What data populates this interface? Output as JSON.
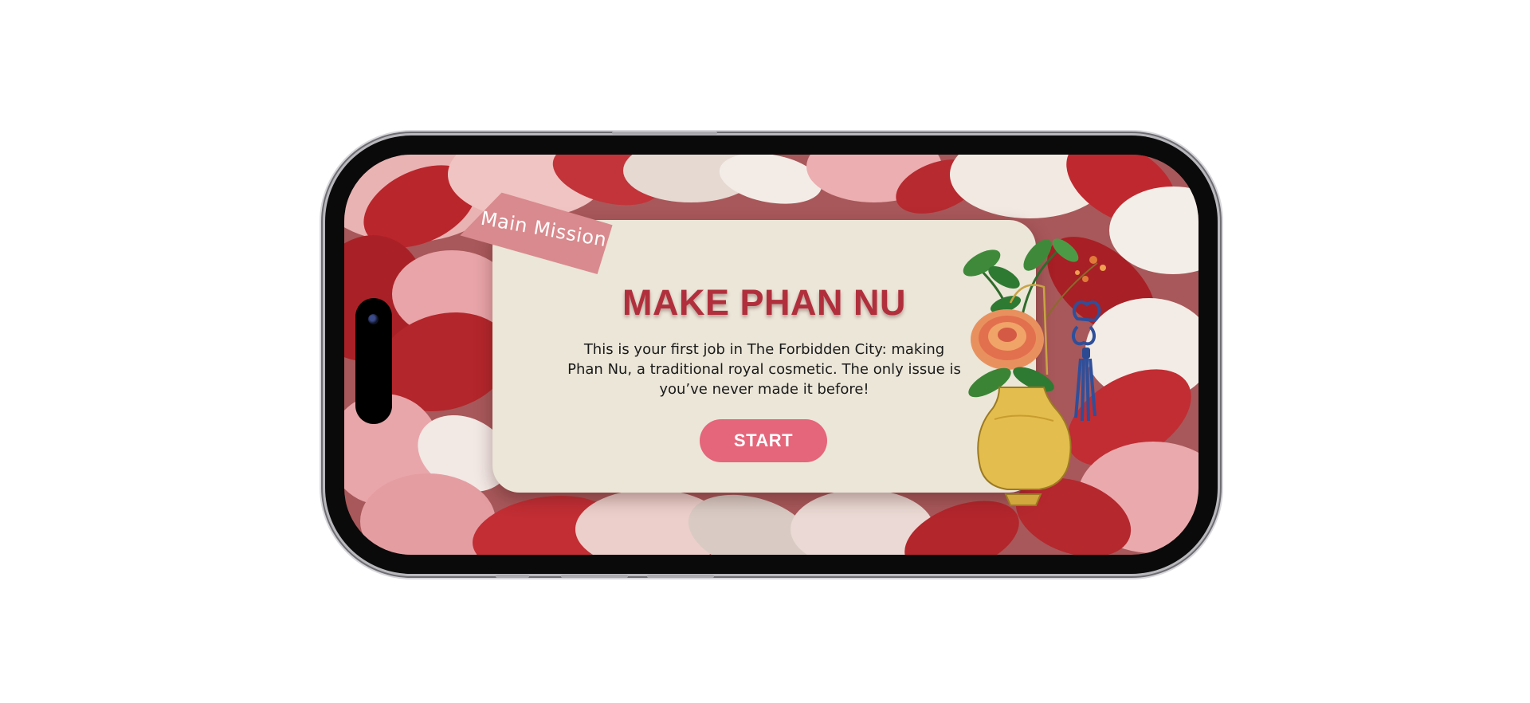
{
  "mission_card": {
    "tag_label": "Main Mission",
    "title": "MAKE PHAN NU",
    "description": "This is your first job in The Forbidden City: making Phan Nu, a traditional royal cosmetic. The only issue is you’ve never made it before!",
    "start_label": "START"
  },
  "colors": {
    "card_background": "#ebe6d8",
    "title": "#b12f3c",
    "start_button": "#e5657a",
    "tag": "#d98a8e",
    "petal_red": "#b8282e",
    "clay_pink": "#e6a9ab"
  },
  "icons": {
    "decoration": "peony-vase-with-tassel-icon",
    "camera": "camera-icon"
  }
}
